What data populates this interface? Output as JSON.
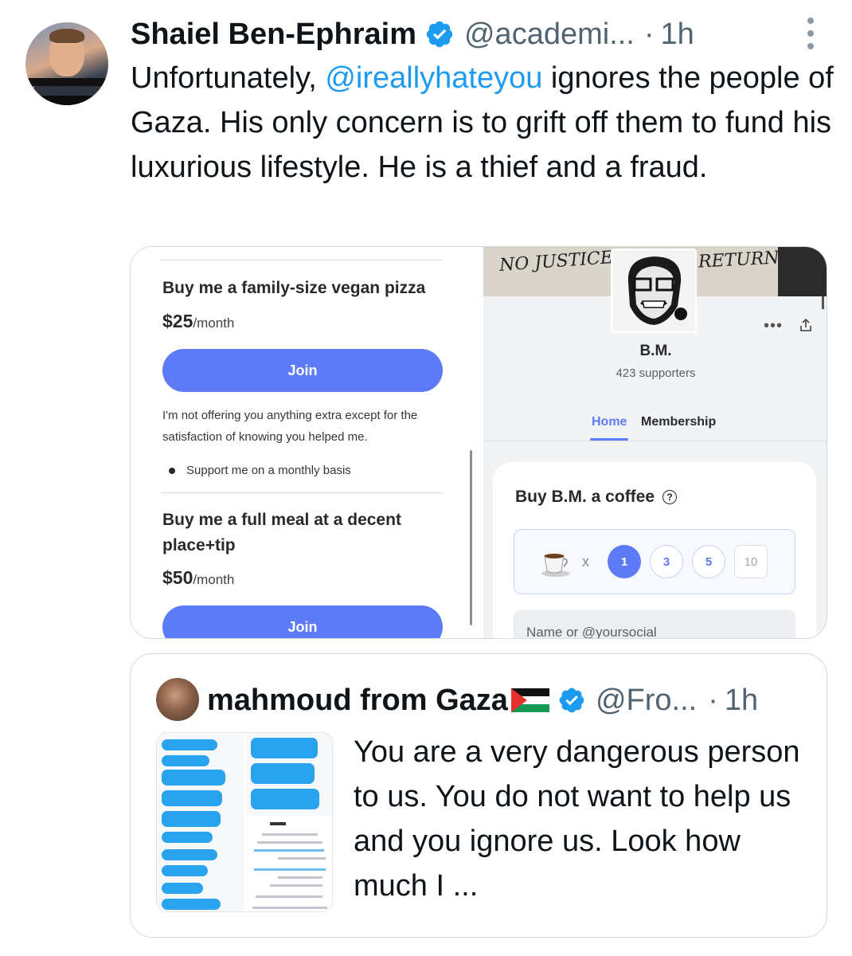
{
  "tweet": {
    "display_name": "Shaiel Ben-Ephraim",
    "handle": "@academi...",
    "dot": "·",
    "time": "1h",
    "text_before": "Unfortunately, ",
    "mention": "@ireallyhateyou",
    "text_after": " ignores the people of Gaza. His only concern is to grift off them to fund his luxurious lifestyle. He is a thief and a fraud."
  },
  "left_screenshot": {
    "tier1_title": "Buy me a family-size vegan pizza",
    "tier1_price": "$25",
    "tier1_period": "/month",
    "join_label": "Join",
    "tier1_desc": "I'm not offering you anything extra except for the satisfaction of knowing you helped me.",
    "tier1_bullet": "Support me on a monthly basis",
    "tier2_title": "Buy me a full meal at a decent place+tip",
    "tier2_price": "$50",
    "tier2_period": "/month"
  },
  "right_screenshot": {
    "banner_left": "NO JUSTICE",
    "banner_right": "RETURN",
    "more": "•••",
    "creator_name": "B.M.",
    "supporters": "423 supporters",
    "tab_home": "Home",
    "tab_membership": "Membership",
    "coffee_title": "Buy B.M. a coffee",
    "help": "?",
    "times": "x",
    "qty_options": [
      "1",
      "3",
      "5",
      "10"
    ],
    "selected_qty": "1",
    "name_placeholder": "Name or @yoursocial"
  },
  "quote_tweet": {
    "display_name": "mahmoud from Gaza",
    "handle": "@Fro...",
    "dot": "·",
    "time": "1h",
    "text": "You are a very dangerous person to us. You do not want to help us and you ignore us. Look how much I ..."
  },
  "colors": {
    "x_blue": "#1d9bf0",
    "muted": "#536471",
    "bmc_accent": "#5e7bf7"
  },
  "icons": [
    "verified-badge-icon",
    "more-icon",
    "share-icon",
    "help-icon",
    "coffee-cup-icon",
    "palestine-flag-icon"
  ]
}
